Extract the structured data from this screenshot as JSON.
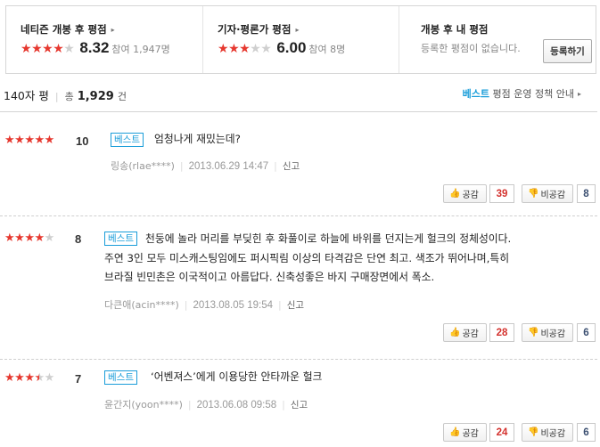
{
  "ratings": {
    "netizen": {
      "title": "네티즌 개봉 후 평점",
      "score": "8.32",
      "participants_label": "참여",
      "participants": "1,947명"
    },
    "critic": {
      "title": "기자·평론가 평점",
      "score": "6.00",
      "participants_label": "참여",
      "participants": "8명"
    },
    "mine": {
      "title": "개봉 후 내 평점",
      "message": "등록한 평점이 없습니다.",
      "button_label": "등록하기"
    },
    "arrow": "▸"
  },
  "summary": {
    "title": "140자 평",
    "total_label": "총",
    "count": "1,929",
    "unit": "건",
    "policy_best": "베스트",
    "policy_rest": "평점 운영 정책 안내"
  },
  "reviews": [
    {
      "stars": 5,
      "score": "10",
      "badge": "베스트",
      "lines": [
        "엄청나게 재밌는데?"
      ],
      "user": "링송(rlae****)",
      "date": "2013.06.29 14:47",
      "report": "신고",
      "likes_label": "공감",
      "likes": "39",
      "dislikes_label": "비공감",
      "dislikes": "8"
    },
    {
      "stars": 4,
      "score": "8",
      "badge": "베스트",
      "lines": [
        "천둥에 놀라 머리를 부딪힌 후 화풀이로 하늘에 바위를 던지는게 헐크의 정체성이다.",
        "주연 3인 모두 미스캐스팅임에도 퍼시픽림 이상의 타격감은 단연 최고. 색조가 뛰어나며,특히",
        "브라질 빈민촌은 이국적이고 아름답다. 신축성좋은 바지 구매장면에서 폭소."
      ],
      "user": "다큰애(acin****)",
      "date": "2013.08.05 19:54",
      "report": "신고",
      "likes_label": "공감",
      "likes": "28",
      "dislikes_label": "비공감",
      "dislikes": "6"
    },
    {
      "stars": 3.5,
      "score": "7",
      "badge": "베스트",
      "lines": [
        "‘어벤져스’에게 이용당한 안타까운 헐크"
      ],
      "user": "윤간지(yoon****)",
      "date": "2013.06.08 09:58",
      "report": "신고",
      "likes_label": "공감",
      "likes": "24",
      "dislikes_label": "비공감",
      "dislikes": "6"
    }
  ],
  "icons": {
    "thumb_up": "thumbs-up-icon",
    "thumb_down": "thumbs-down-icon",
    "star": "star-icon"
  },
  "colors": {
    "star_on": "#e6382f",
    "star_off": "#cfcfcf",
    "best": "#1a9dd9",
    "like_count": "#d4322e",
    "dislike_count": "#3a4e70"
  }
}
